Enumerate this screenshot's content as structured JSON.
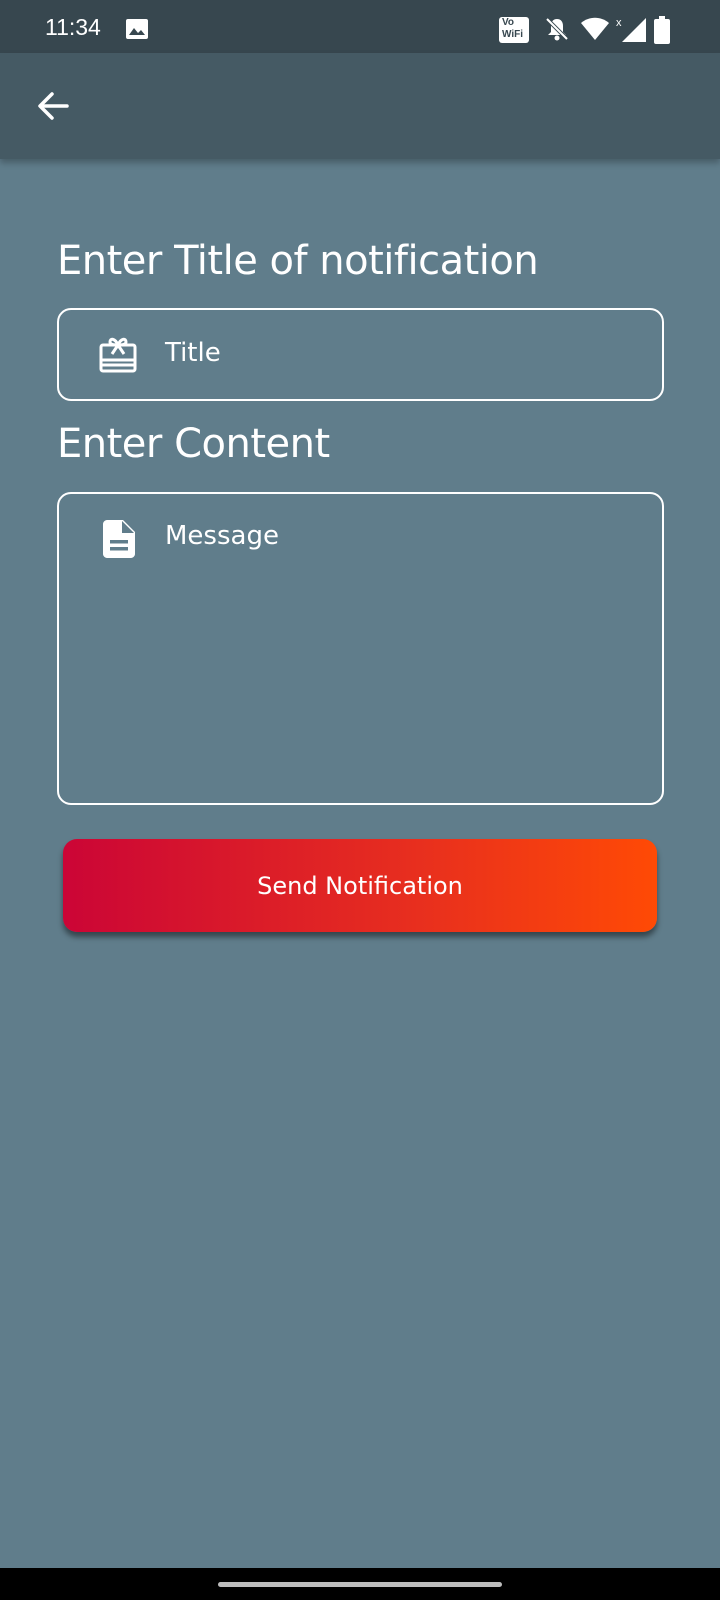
{
  "status_bar": {
    "time": "11:34",
    "icons": [
      "gallery-icon",
      "vowifi-icon",
      "notifications-off-icon",
      "wifi-icon",
      "signal-icon",
      "battery-icon"
    ],
    "vowifi_top": "Vo",
    "vowifi_bottom": "WiFi"
  },
  "app_bar": {
    "back_icon": "arrow-back-icon"
  },
  "form": {
    "title_label": "Enter Title of notification",
    "title_placeholder": "Title",
    "title_icon": "card-giftcard-icon",
    "content_label": "Enter Content",
    "content_placeholder": "Message",
    "content_icon": "description-icon"
  },
  "send_button": {
    "label": "Send Notification"
  },
  "colors": {
    "background": "#607d8b",
    "app_bar": "#455a64",
    "status_bar": "#37474f",
    "button_gradient_start": "#cb0536",
    "button_gradient_end": "#ff4a05"
  }
}
